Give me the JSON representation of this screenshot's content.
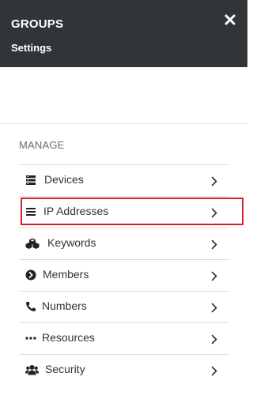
{
  "header": {
    "title": "GROUPS",
    "subtitle": "Settings",
    "close_icon": "close-icon"
  },
  "section": {
    "title": "MANAGE"
  },
  "menu": {
    "items": [
      {
        "label": "Devices",
        "icon": "devices-icon"
      },
      {
        "label": "IP Addresses",
        "icon": "list-icon"
      },
      {
        "label": "Keywords",
        "icon": "cubes-icon"
      },
      {
        "label": "Members",
        "icon": "chevron-circle-icon"
      },
      {
        "label": "Numbers",
        "icon": "phone-icon"
      },
      {
        "label": "Resources",
        "icon": "ellipsis-icon"
      },
      {
        "label": "Security",
        "icon": "users-icon"
      }
    ]
  },
  "colors": {
    "header_bg": "#323538",
    "highlight_border": "#d61f2b"
  }
}
